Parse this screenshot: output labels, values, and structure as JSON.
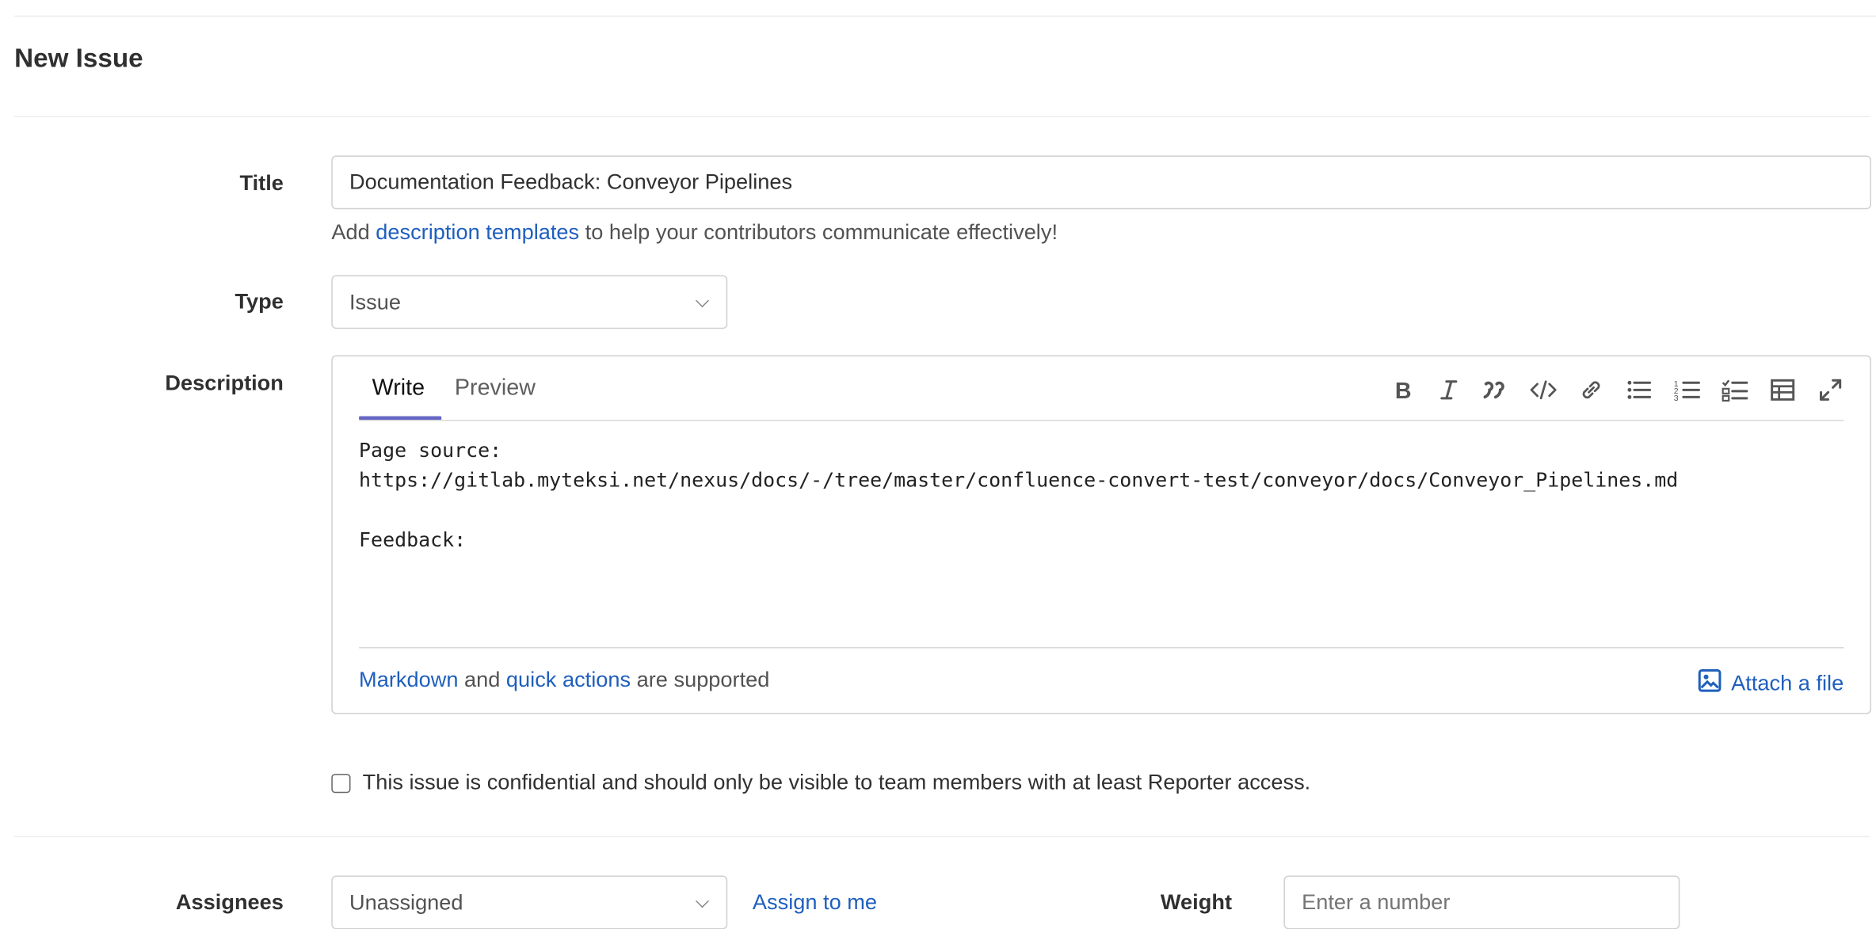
{
  "page_title": "New Issue",
  "title_field": {
    "label": "Title",
    "value": "Documentation Feedback: Conveyor Pipelines"
  },
  "hint": {
    "prefix": "Add ",
    "link": "description templates",
    "suffix": " to help your contributors communicate effectively!"
  },
  "type_field": {
    "label": "Type",
    "value": "Issue"
  },
  "description": {
    "label": "Description",
    "tabs": [
      "Write",
      "Preview"
    ],
    "active_tab": "Write",
    "toolbar_icons": [
      "bold-icon",
      "italic-icon",
      "quote-icon",
      "code-icon",
      "link-icon",
      "bullet-list-icon",
      "numbered-list-icon",
      "task-list-icon",
      "table-icon",
      "fullscreen-icon"
    ],
    "body": "Page source:\nhttps://gitlab.myteksi.net/nexus/docs/-/tree/master/confluence-convert-test/conveyor/docs/Conveyor_Pipelines.md\n\nFeedback:",
    "footer": {
      "markdown_link": "Markdown",
      "and": " and ",
      "quick_actions_link": "quick actions",
      "suffix": " are supported"
    },
    "attach_label": "Attach a file"
  },
  "confidential": {
    "label": "This issue is confidential and should only be visible to team members with at least Reporter access.",
    "checked": false
  },
  "assignees": {
    "label": "Assignees",
    "value": "Unassigned",
    "assign_to_me": "Assign to me"
  },
  "weight": {
    "label": "Weight",
    "placeholder": "Enter a number"
  },
  "colors": {
    "link": "#1f5fbd",
    "tab_accent": "#6666c4",
    "border": "#d0d0d0"
  }
}
